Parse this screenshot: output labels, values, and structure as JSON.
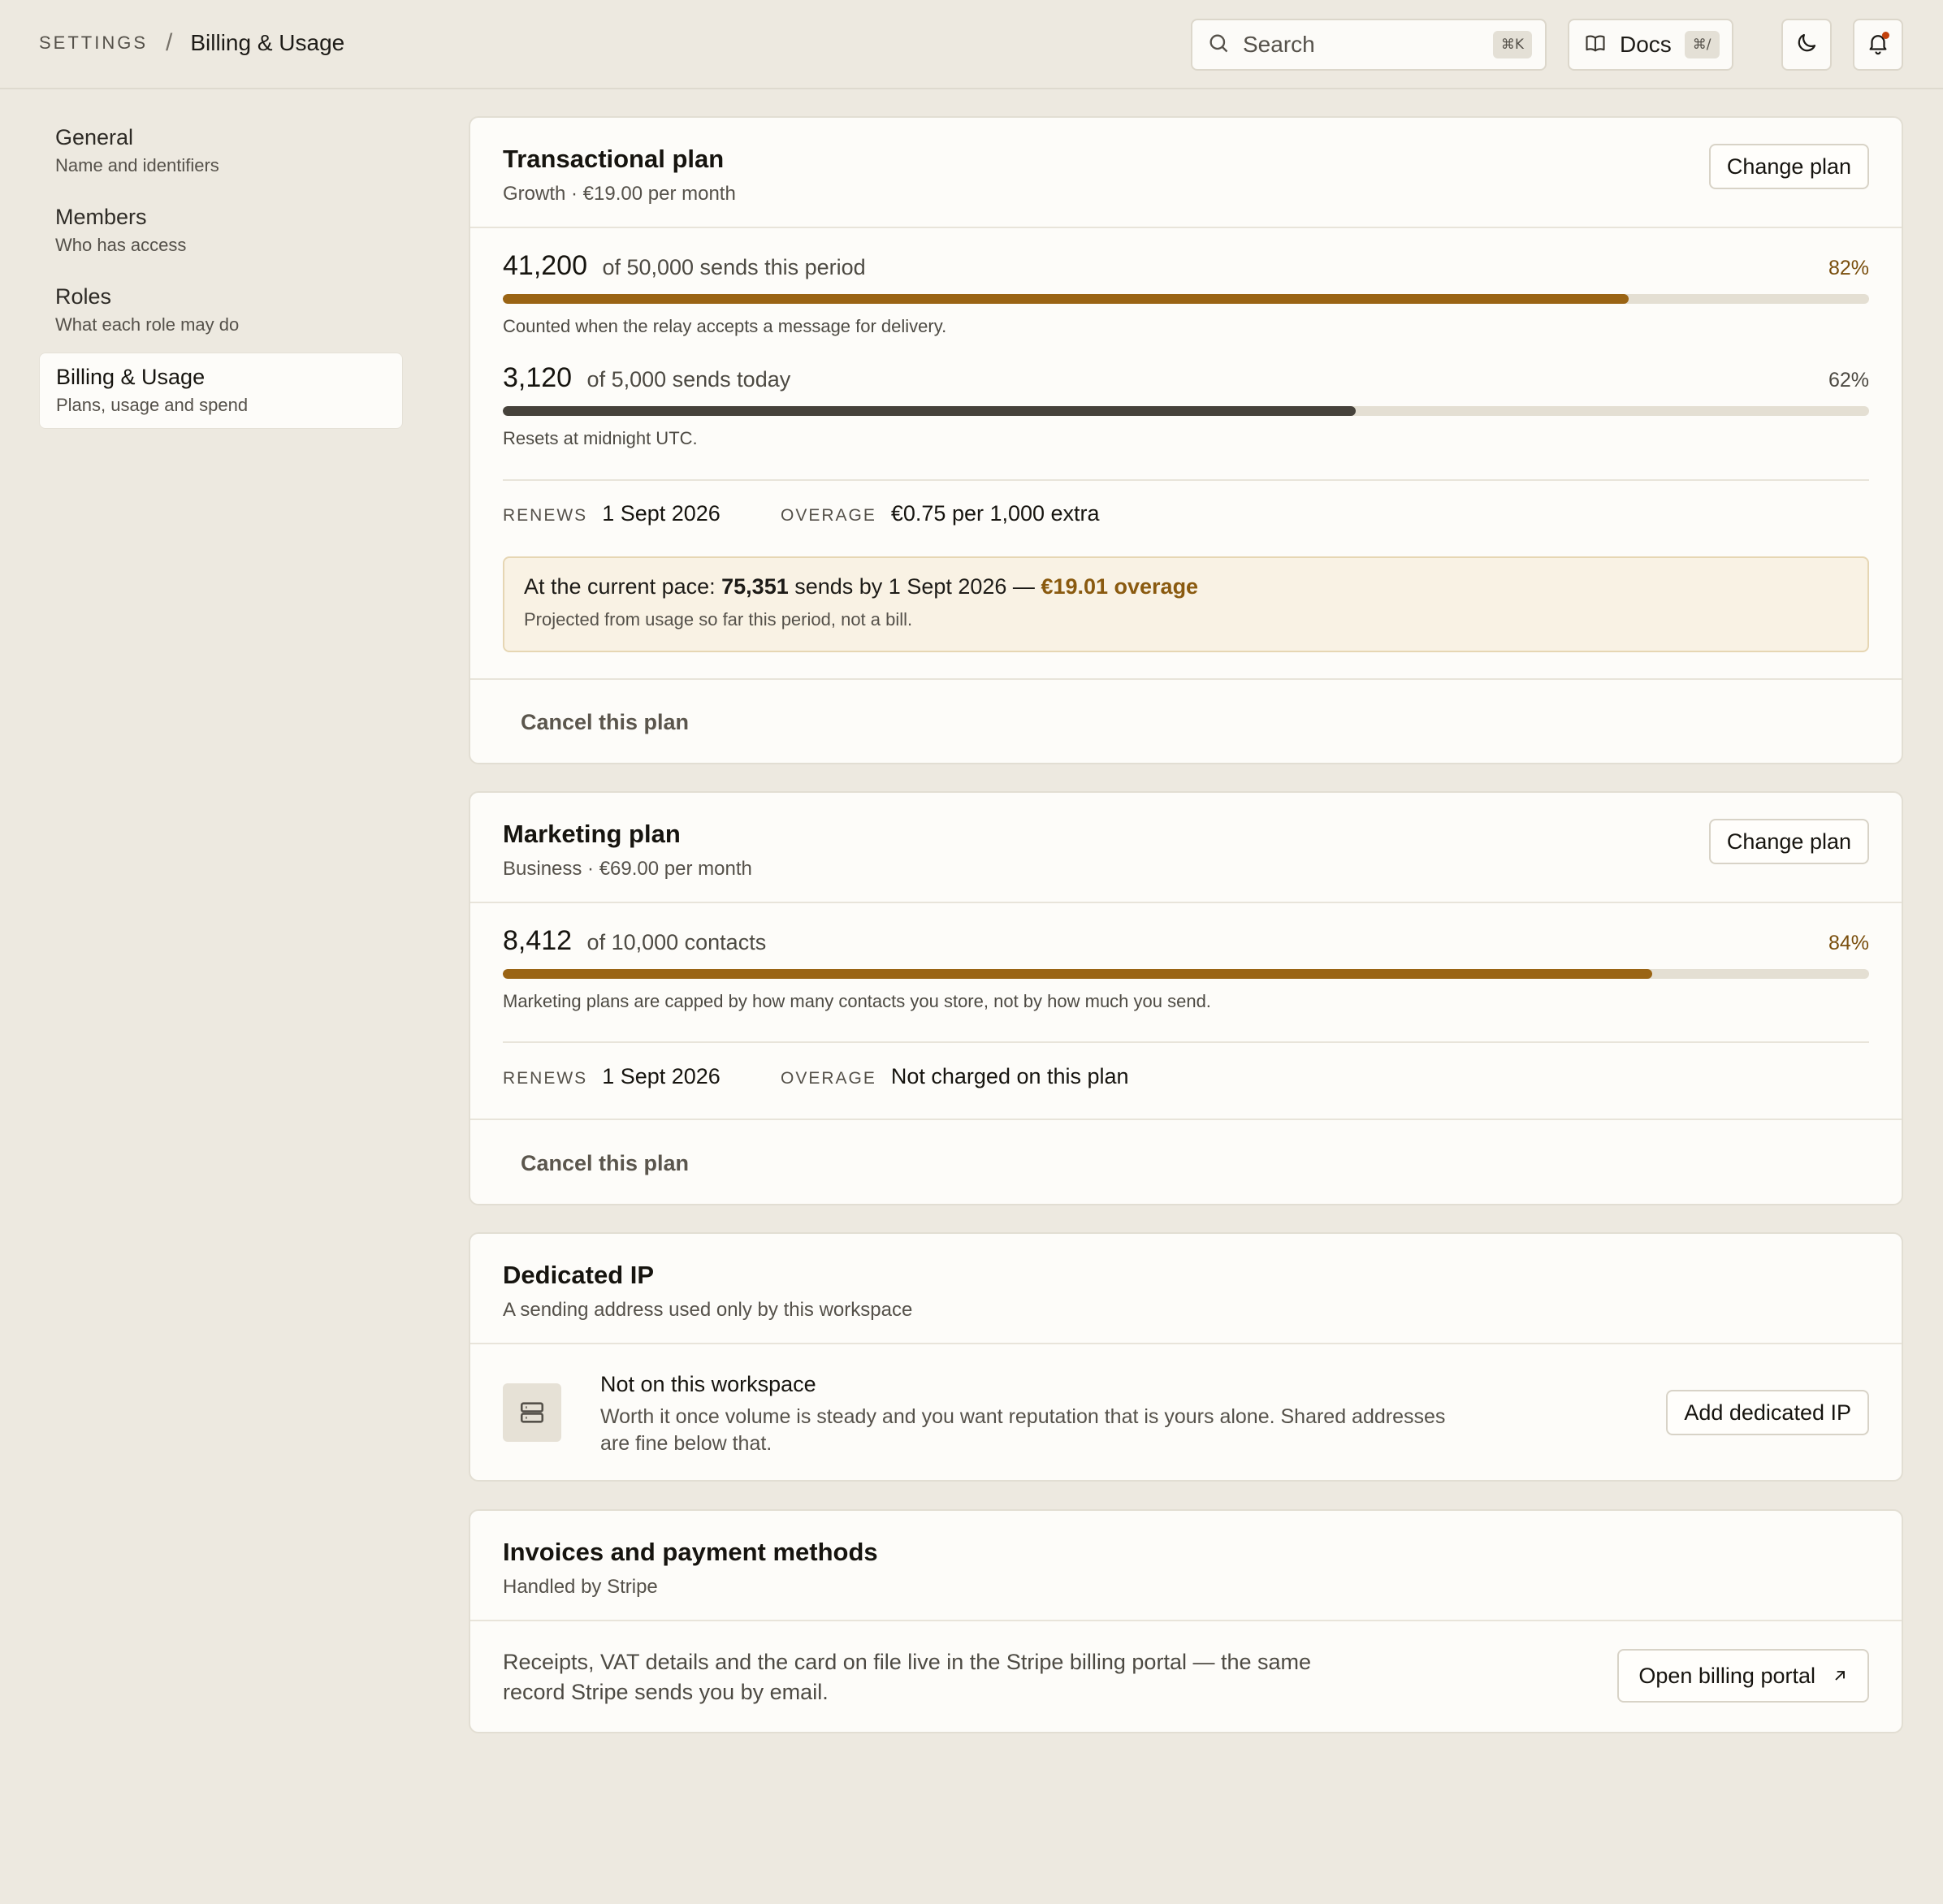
{
  "breadcrumb": {
    "root": "SETTINGS",
    "separator": "/",
    "current": "Billing & Usage"
  },
  "topbar": {
    "search_label": "Search",
    "search_shortcut": "⌘K",
    "docs_label": "Docs",
    "docs_shortcut": "⌘/"
  },
  "sidebar": {
    "items": [
      {
        "label": "General",
        "sub": "Name and identifiers",
        "active": false
      },
      {
        "label": "Members",
        "sub": "Who has access",
        "active": false
      },
      {
        "label": "Roles",
        "sub": "What each role may do",
        "active": false
      },
      {
        "label": "Billing & Usage",
        "sub": "Plans, usage and spend",
        "active": true
      }
    ]
  },
  "transactional": {
    "title": "Transactional plan",
    "subtitle": "Growth · €19.00 per month",
    "change_label": "Change plan",
    "period": {
      "used": "41,200",
      "of": "of 50,000 sends this period",
      "pct_label": "82%",
      "fraction": 0.824,
      "note": "Counted when the relay accepts a message for delivery."
    },
    "today": {
      "used": "3,120",
      "of": "of 5,000 sends today",
      "pct_label": "62%",
      "fraction": 0.624,
      "note": "Resets at midnight UTC."
    },
    "renews_key": "RENEWS",
    "renews_value": "1 Sept 2026",
    "overage_key": "OVERAGE",
    "overage_value": "€0.75 per 1,000 extra",
    "projection": {
      "prefix": "At the current pace: ",
      "sends": "75,351",
      "middle": " sends by 1 Sept 2026 — ",
      "overage": "€19.01 overage",
      "note": "Projected from usage so far this period, not a bill."
    },
    "cancel_label": "Cancel this plan"
  },
  "marketing": {
    "title": "Marketing plan",
    "subtitle": "Business · €69.00 per month",
    "change_label": "Change plan",
    "contacts": {
      "used": "8,412",
      "of": "of 10,000 contacts",
      "pct_label": "84%",
      "fraction": 0.8412,
      "note": "Marketing plans are capped by how many contacts you store, not by how much you send."
    },
    "renews_key": "RENEWS",
    "renews_value": "1 Sept 2026",
    "overage_key": "OVERAGE",
    "overage_value": "Not charged on this plan",
    "cancel_label": "Cancel this plan"
  },
  "dedicated_ip": {
    "title": "Dedicated IP",
    "subtitle": "A sending address used only by this workspace",
    "status": "Not on this workspace",
    "description": "Worth it once volume is steady and you want reputation that is yours alone. Shared addresses are fine below that.",
    "button": "Add dedicated IP",
    "icon": "server-icon"
  },
  "invoices": {
    "title": "Invoices and payment methods",
    "subtitle": "Handled by Stripe",
    "description": "Receipts, VAT details and the card on file live in the Stripe billing portal — the same record Stripe sends you by email.",
    "button": "Open billing portal",
    "icon": "external-link-icon"
  },
  "colors": {
    "accent": "#9a6414",
    "accent_text": "#7a4f0e",
    "bar_dark": "#46423b",
    "track": "#e4dfd3",
    "background": "#ede9e0",
    "card": "#fdfcf9"
  }
}
